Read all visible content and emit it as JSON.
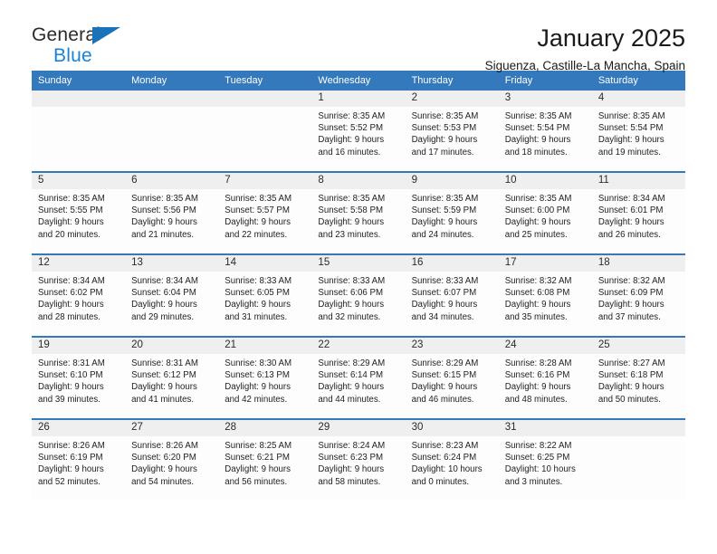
{
  "brand": {
    "name_part1": "General",
    "name_part2": "Blue",
    "triangle_icon": "triangle-logo-icon",
    "color_dark": "#2b2b2b",
    "color_blue": "#1a82d8"
  },
  "header": {
    "title": "January 2025",
    "subtitle": "Siguenza, Castille-La Mancha, Spain"
  },
  "theme": {
    "header_blue": "#3479bb",
    "daynum_band": "#efefef",
    "cell_bg": "#fdfdfd"
  },
  "calendar": {
    "weekday_headers": [
      "Sunday",
      "Monday",
      "Tuesday",
      "Wednesday",
      "Thursday",
      "Friday",
      "Saturday"
    ],
    "weeks": [
      [
        {
          "day": "",
          "lines": []
        },
        {
          "day": "",
          "lines": []
        },
        {
          "day": "",
          "lines": []
        },
        {
          "day": "1",
          "lines": [
            "Sunrise: 8:35 AM",
            "Sunset: 5:52 PM",
            "Daylight: 9 hours",
            "and 16 minutes."
          ]
        },
        {
          "day": "2",
          "lines": [
            "Sunrise: 8:35 AM",
            "Sunset: 5:53 PM",
            "Daylight: 9 hours",
            "and 17 minutes."
          ]
        },
        {
          "day": "3",
          "lines": [
            "Sunrise: 8:35 AM",
            "Sunset: 5:54 PM",
            "Daylight: 9 hours",
            "and 18 minutes."
          ]
        },
        {
          "day": "4",
          "lines": [
            "Sunrise: 8:35 AM",
            "Sunset: 5:54 PM",
            "Daylight: 9 hours",
            "and 19 minutes."
          ]
        }
      ],
      [
        {
          "day": "5",
          "lines": [
            "Sunrise: 8:35 AM",
            "Sunset: 5:55 PM",
            "Daylight: 9 hours",
            "and 20 minutes."
          ]
        },
        {
          "day": "6",
          "lines": [
            "Sunrise: 8:35 AM",
            "Sunset: 5:56 PM",
            "Daylight: 9 hours",
            "and 21 minutes."
          ]
        },
        {
          "day": "7",
          "lines": [
            "Sunrise: 8:35 AM",
            "Sunset: 5:57 PM",
            "Daylight: 9 hours",
            "and 22 minutes."
          ]
        },
        {
          "day": "8",
          "lines": [
            "Sunrise: 8:35 AM",
            "Sunset: 5:58 PM",
            "Daylight: 9 hours",
            "and 23 minutes."
          ]
        },
        {
          "day": "9",
          "lines": [
            "Sunrise: 8:35 AM",
            "Sunset: 5:59 PM",
            "Daylight: 9 hours",
            "and 24 minutes."
          ]
        },
        {
          "day": "10",
          "lines": [
            "Sunrise: 8:35 AM",
            "Sunset: 6:00 PM",
            "Daylight: 9 hours",
            "and 25 minutes."
          ]
        },
        {
          "day": "11",
          "lines": [
            "Sunrise: 8:34 AM",
            "Sunset: 6:01 PM",
            "Daylight: 9 hours",
            "and 26 minutes."
          ]
        }
      ],
      [
        {
          "day": "12",
          "lines": [
            "Sunrise: 8:34 AM",
            "Sunset: 6:02 PM",
            "Daylight: 9 hours",
            "and 28 minutes."
          ]
        },
        {
          "day": "13",
          "lines": [
            "Sunrise: 8:34 AM",
            "Sunset: 6:04 PM",
            "Daylight: 9 hours",
            "and 29 minutes."
          ]
        },
        {
          "day": "14",
          "lines": [
            "Sunrise: 8:33 AM",
            "Sunset: 6:05 PM",
            "Daylight: 9 hours",
            "and 31 minutes."
          ]
        },
        {
          "day": "15",
          "lines": [
            "Sunrise: 8:33 AM",
            "Sunset: 6:06 PM",
            "Daylight: 9 hours",
            "and 32 minutes."
          ]
        },
        {
          "day": "16",
          "lines": [
            "Sunrise: 8:33 AM",
            "Sunset: 6:07 PM",
            "Daylight: 9 hours",
            "and 34 minutes."
          ]
        },
        {
          "day": "17",
          "lines": [
            "Sunrise: 8:32 AM",
            "Sunset: 6:08 PM",
            "Daylight: 9 hours",
            "and 35 minutes."
          ]
        },
        {
          "day": "18",
          "lines": [
            "Sunrise: 8:32 AM",
            "Sunset: 6:09 PM",
            "Daylight: 9 hours",
            "and 37 minutes."
          ]
        }
      ],
      [
        {
          "day": "19",
          "lines": [
            "Sunrise: 8:31 AM",
            "Sunset: 6:10 PM",
            "Daylight: 9 hours",
            "and 39 minutes."
          ]
        },
        {
          "day": "20",
          "lines": [
            "Sunrise: 8:31 AM",
            "Sunset: 6:12 PM",
            "Daylight: 9 hours",
            "and 41 minutes."
          ]
        },
        {
          "day": "21",
          "lines": [
            "Sunrise: 8:30 AM",
            "Sunset: 6:13 PM",
            "Daylight: 9 hours",
            "and 42 minutes."
          ]
        },
        {
          "day": "22",
          "lines": [
            "Sunrise: 8:29 AM",
            "Sunset: 6:14 PM",
            "Daylight: 9 hours",
            "and 44 minutes."
          ]
        },
        {
          "day": "23",
          "lines": [
            "Sunrise: 8:29 AM",
            "Sunset: 6:15 PM",
            "Daylight: 9 hours",
            "and 46 minutes."
          ]
        },
        {
          "day": "24",
          "lines": [
            "Sunrise: 8:28 AM",
            "Sunset: 6:16 PM",
            "Daylight: 9 hours",
            "and 48 minutes."
          ]
        },
        {
          "day": "25",
          "lines": [
            "Sunrise: 8:27 AM",
            "Sunset: 6:18 PM",
            "Daylight: 9 hours",
            "and 50 minutes."
          ]
        }
      ],
      [
        {
          "day": "26",
          "lines": [
            "Sunrise: 8:26 AM",
            "Sunset: 6:19 PM",
            "Daylight: 9 hours",
            "and 52 minutes."
          ]
        },
        {
          "day": "27",
          "lines": [
            "Sunrise: 8:26 AM",
            "Sunset: 6:20 PM",
            "Daylight: 9 hours",
            "and 54 minutes."
          ]
        },
        {
          "day": "28",
          "lines": [
            "Sunrise: 8:25 AM",
            "Sunset: 6:21 PM",
            "Daylight: 9 hours",
            "and 56 minutes."
          ]
        },
        {
          "day": "29",
          "lines": [
            "Sunrise: 8:24 AM",
            "Sunset: 6:23 PM",
            "Daylight: 9 hours",
            "and 58 minutes."
          ]
        },
        {
          "day": "30",
          "lines": [
            "Sunrise: 8:23 AM",
            "Sunset: 6:24 PM",
            "Daylight: 10 hours",
            "and 0 minutes."
          ]
        },
        {
          "day": "31",
          "lines": [
            "Sunrise: 8:22 AM",
            "Sunset: 6:25 PM",
            "Daylight: 10 hours",
            "and 3 minutes."
          ]
        },
        {
          "day": "",
          "lines": []
        }
      ]
    ]
  }
}
